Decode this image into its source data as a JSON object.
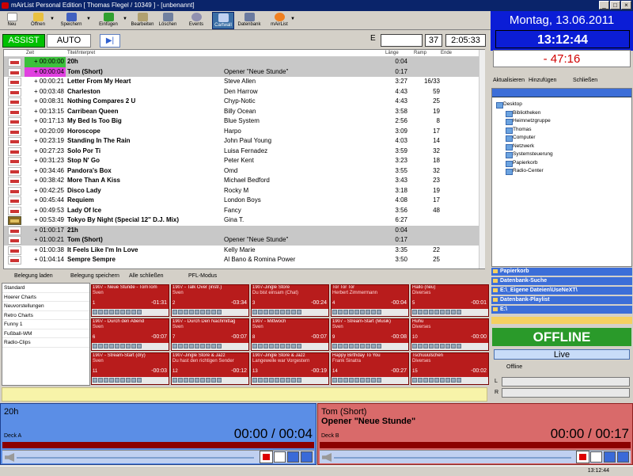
{
  "window": {
    "title": "mAirList Personal Edition [ Thomas Flegel / 10349 ] - [unbenannt]"
  },
  "toolbar": {
    "neu": "Neu",
    "oeffnen": "Öffnen",
    "speichern": "Speichern",
    "einfuegen": "Einfügen",
    "bearbeiten": "Bearbeiten",
    "loeschen": "Löschen",
    "events": "Events",
    "cartwall": "Cartwall",
    "datenbank": "Datenbank",
    "mairlist": "mAirList"
  },
  "clock": {
    "date": "Montag, 13.06.2011",
    "time": "13:12:44",
    "countdown": "- 47:16"
  },
  "mode": {
    "assist": "ASSIST",
    "auto": "AUTO",
    "e_label": "E",
    "count": "37",
    "total": "2:05:33"
  },
  "playlist": {
    "headers": {
      "zeit": "Zeit",
      "titel": "Titel/Interpret",
      "laenge": "Länge",
      "ramp": "Ramp",
      "ende": "Ende"
    },
    "rows": [
      {
        "time": "+ 00:00:00",
        "title": "20h",
        "artist": "",
        "length": "0:04",
        "ramp": "",
        "sep": true,
        "hl": "hl1"
      },
      {
        "time": "+ 00:00:04",
        "title": "Tom (Short)",
        "artist": "Opener \"Neue Stunde\"",
        "length": "0:17",
        "ramp": "",
        "sep": true,
        "hl": "hl2"
      },
      {
        "time": "+ 00:00:21",
        "title": "Letter From My Heart",
        "artist": "Steve Allen",
        "length": "3:27",
        "ramp": "16/33"
      },
      {
        "time": "+ 00:03:48",
        "title": "Charleston",
        "artist": "Den Harrow",
        "length": "4:43",
        "ramp": "59"
      },
      {
        "time": "+ 00:08:31",
        "title": "Nothing Compares 2 U",
        "artist": "Chyp-Notic",
        "length": "4:43",
        "ramp": "25"
      },
      {
        "time": "+ 00:13:15",
        "title": "Carribean Queen",
        "artist": "Billy Ocean",
        "length": "3:58",
        "ramp": "19"
      },
      {
        "time": "+ 00:17:13",
        "title": "My Bed Is Too Big",
        "artist": "Blue System",
        "length": "2:56",
        "ramp": "8"
      },
      {
        "time": "+ 00:20:09",
        "title": "Horoscope",
        "artist": "Harpo",
        "length": "3:09",
        "ramp": "17"
      },
      {
        "time": "+ 00:23:19",
        "title": "Standing In The Rain",
        "artist": "John Paul Young",
        "length": "4:03",
        "ramp": "14"
      },
      {
        "time": "+ 00:27:23",
        "title": "Solo Por Ti",
        "artist": "Luisa Fernadez",
        "length": "3:59",
        "ramp": "32"
      },
      {
        "time": "+ 00:31:23",
        "title": "Stop N' Go",
        "artist": "Peter Kent",
        "length": "3:23",
        "ramp": "18"
      },
      {
        "time": "+ 00:34:46",
        "title": "Pandora's Box",
        "artist": "Omd",
        "length": "3:55",
        "ramp": "32"
      },
      {
        "time": "+ 00:38:42",
        "title": "More Than A Kiss",
        "artist": "Michael Bedford",
        "length": "3:43",
        "ramp": "23"
      },
      {
        "time": "+ 00:42:25",
        "title": "Disco Lady",
        "artist": "Rocky M",
        "length": "3:18",
        "ramp": "19"
      },
      {
        "time": "+ 00:45:44",
        "title": "Requiem",
        "artist": "London Boys",
        "length": "4:08",
        "ramp": "17"
      },
      {
        "time": "+ 00:49:53",
        "title": "Lady Of Ice",
        "artist": "Fancy",
        "length": "3:56",
        "ramp": "48"
      },
      {
        "time": "+ 00:53:49",
        "title": "Tokyo By Night (Special 12'' D.J. Mix)",
        "artist": "Gina T.",
        "length": "6:27",
        "ramp": "",
        "cover": true
      },
      {
        "time": "+ 01:00:17",
        "title": "21h",
        "artist": "",
        "length": "0:04",
        "ramp": "",
        "sep": true
      },
      {
        "time": "+ 01:00:21",
        "title": "Tom (Short)",
        "artist": "Opener \"Neue Stunde\"",
        "length": "0:17",
        "ramp": "",
        "sep": true
      },
      {
        "time": "+ 01:00:38",
        "title": "It Feels Like I'm In Love",
        "artist": "Kelly Marie",
        "length": "3:35",
        "ramp": "22"
      },
      {
        "time": "+ 01:04:14",
        "title": "Sempre Sempre",
        "artist": "Al Bano & Romina Power",
        "length": "3:50",
        "ramp": "25"
      }
    ]
  },
  "cartbar": {
    "laden": "Belegung laden",
    "speichern": "Belegung speichern",
    "schliessen": "Alle schließen",
    "pfl": "PFL-Modus"
  },
  "cartlist": [
    "Standard",
    "Hoerer Charts",
    "Neuvorstellungen",
    "Retro Charts",
    "Funny 1",
    "Fußball-WM",
    "Radio-Clips"
  ],
  "carts": [
    {
      "title": "1907 - Neue Stunde - TomTom",
      "artist": "Sven",
      "num": "1",
      "dur": "-01:31"
    },
    {
      "title": "1907 - Talk Over (instr.)",
      "artist": "Sven",
      "num": "2",
      "dur": "-03:34"
    },
    {
      "title": "1907-Jingle Store",
      "artist": "Du bist einsam (Chat)",
      "num": "3",
      "dur": "-00:24"
    },
    {
      "title": "Tor Tor Tor",
      "artist": "Herbert Zimmermann",
      "num": "4",
      "dur": "-00:04"
    },
    {
      "title": "Hallo (neu)",
      "artist": "Diverses",
      "num": "5",
      "dur": "-00:01"
    },
    {
      "title": "1907 - Durch den Abend",
      "artist": "Sven",
      "num": "6",
      "dur": "-00:07"
    },
    {
      "title": "1907 - Durch Den Nachmittag",
      "artist": "Sven",
      "num": "7",
      "dur": "-00:07"
    },
    {
      "title": "1907 - Mittwoch",
      "artist": "Sven",
      "num": "8",
      "dur": "-00:07"
    },
    {
      "title": "1907 - Stream-Start (Musik)",
      "artist": "Sven",
      "num": "9",
      "dur": "-00:08"
    },
    {
      "title": "Huhu",
      "artist": "Diverses",
      "num": "10",
      "dur": "-00:00"
    },
    {
      "title": "1907 - Stream-Start (dry)",
      "artist": "Sven",
      "num": "11",
      "dur": "-00:03"
    },
    {
      "title": "1907-Jingle Store & Jazz",
      "artist": "Du hast den richtigen Sender",
      "num": "12",
      "dur": "-00:12"
    },
    {
      "title": "1907-Jingle Store & Jazz",
      "artist": "Langeweile war Vorgestern",
      "num": "13",
      "dur": "-00:19"
    },
    {
      "title": "Happy Birthday To You",
      "artist": "Frank Sinatra",
      "num": "14",
      "dur": "-00:27"
    },
    {
      "title": "Tschüüüßchen",
      "artist": "Diverses",
      "num": "15",
      "dur": "-00:02"
    }
  ],
  "deckA": {
    "title": "20h",
    "artist": "",
    "label": "Deck A",
    "time": "00:00 / 00:04"
  },
  "deckB": {
    "title": "Tom (Short)",
    "artist": "Opener \"Neue Stunde\"",
    "label": "Deck B",
    "time": "00:00 / 00:17"
  },
  "rtools": {
    "aktualisieren": "Aktualisieren",
    "hinzufuegen": "Hinzufügen",
    "schliessen": "Schließen"
  },
  "browser": {
    "items": [
      "Desktop",
      "Bibliotheken",
      "Heimnetzgruppe",
      "Thomas",
      "Computer",
      "Netzwerk",
      "Systemsteuerung",
      "Papierkorb",
      "Radio-Center"
    ]
  },
  "groups": [
    "Papierkorb",
    "Datenbank-Suche",
    "E:\\_Eigene Dateien\\UseNeXT\\",
    "Datenbank-Playlist",
    "E:\\"
  ],
  "live": {
    "status": "OFFLINE",
    "header": "Live",
    "offline_label": "Offline",
    "l": "L",
    "r": "R"
  },
  "status": {
    "time": "13:12:44"
  },
  "colors": {
    "deckA": "#5b8ee6",
    "deckB": "#d96a6a",
    "cart": "#b81c1c",
    "offline": "#2a9a2a",
    "clock": "#0b1dd6"
  }
}
